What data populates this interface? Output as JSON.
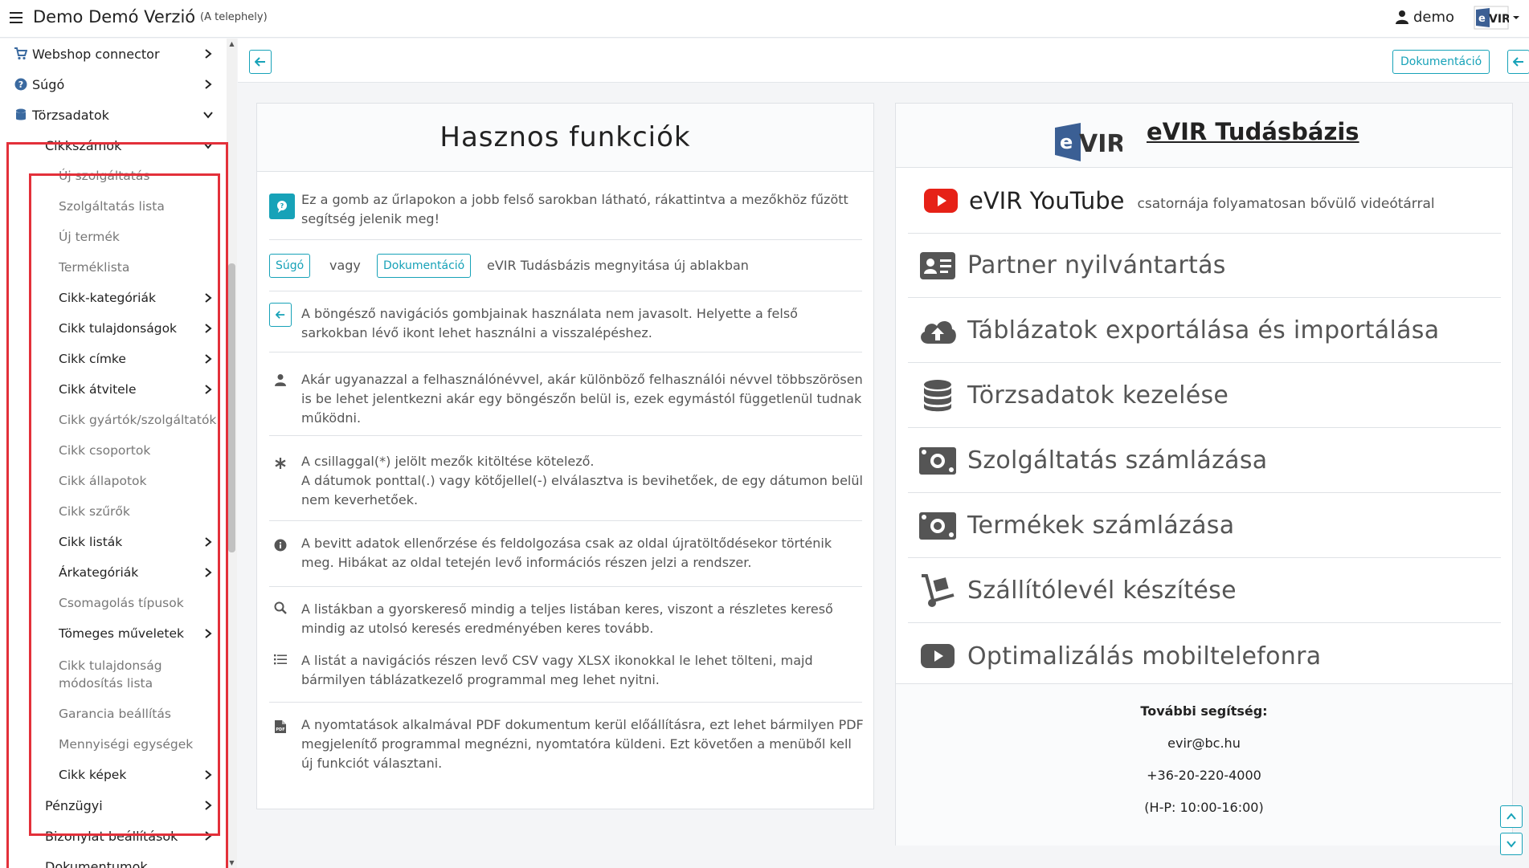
{
  "header": {
    "title": "Demo Demó Verzió",
    "subtitle": "(A telephely)",
    "user_name": "demo",
    "logo_text": "eVIR"
  },
  "sidebar": {
    "items_top": [
      {
        "label": "Webshop connector",
        "icon": "cart-icon"
      },
      {
        "label": "Súgó",
        "icon": "question-circle-icon"
      },
      {
        "label": "Törzsadatok",
        "icon": "database-icon",
        "expanded": true
      }
    ],
    "group": {
      "label": "Cikkszámok",
      "expanded": true
    },
    "sub_items": [
      {
        "label": "Új szolgáltatás",
        "has_children": false
      },
      {
        "label": "Szolgáltatás lista",
        "has_children": false
      },
      {
        "label": "Új termék",
        "has_children": false
      },
      {
        "label": "Terméklista",
        "has_children": false
      },
      {
        "label": "Cikk-kategóriák",
        "has_children": true
      },
      {
        "label": "Cikk tulajdonságok",
        "has_children": true
      },
      {
        "label": "Cikk címke",
        "has_children": true
      },
      {
        "label": "Cikk átvitele",
        "has_children": true
      },
      {
        "label": "Cikk gyártók/szolgáltatók",
        "has_children": false
      },
      {
        "label": "Cikk csoportok",
        "has_children": false
      },
      {
        "label": "Cikk állapotok",
        "has_children": false
      },
      {
        "label": "Cikk szűrők",
        "has_children": false
      },
      {
        "label": "Cikk listák",
        "has_children": true
      },
      {
        "label": "Árkategóriák",
        "has_children": true
      },
      {
        "label": "Csomagolás típusok",
        "has_children": false
      },
      {
        "label": "Tömeges műveletek",
        "has_children": true
      },
      {
        "label_line1": "Cikk tulajdonság",
        "label_line2": "módosítás lista",
        "has_children": false
      },
      {
        "label": "Garancia beállítás",
        "has_children": false
      },
      {
        "label": "Mennyiségi egységek",
        "has_children": false
      },
      {
        "label": "Cikk képek",
        "has_children": true
      }
    ],
    "items_after": [
      {
        "label": "Pénzügyi"
      },
      {
        "label": "Bizonylat beállítások"
      },
      {
        "label": "Dokumentumok"
      }
    ],
    "highlight_color": "#e3303a"
  },
  "toolbar": {
    "documentation_label": "Dokumentáció"
  },
  "useful": {
    "title": "Hasznos funkciók",
    "help_text": "Ez a gomb az űrlapokon a jobb felső sarokban látható, rákattintva a mezőkhöz fűzött segítség jelenik meg!",
    "sugo_label": "Súgó",
    "or_text": "vagy",
    "doc_label": "Dokumentáció",
    "kb_open_text": "eVIR Tudásbázis megnyitása új ablakban",
    "nav_text": "A böngésző navigációs gombjainak használata nem javasolt. Helyette a felső sarkokban lévő ikont lehet használni a visszalépéshez.",
    "user_text": "Akár ugyanazzal a felhasználónévvel, akár különböző felhasználói névvel többszörösen is be lehet jelentkezni akár egy böngészőn belül is, ezek egymástól függetlenül tudnak működni.",
    "star_text": "A csillaggal(*) jelölt mezők kitöltése kötelező.",
    "date_text": "A dátumok ponttal(.) vagy kötőjellel(-) elválasztva is bevihetőek, de egy dátumon belül nem keverhetőek.",
    "info_text": "A bevitt adatok ellenőrzése és feldolgozása csak az oldal újratöltődésekor történik meg. Hibákat az oldal tetején levő információs részen jelzi a rendszer.",
    "search_text": "A listákban a gyorskereső mindig a teljes listában keres, viszont a részletes kereső mindig az utolsó keresés eredményében keres tovább.",
    "list_text": "A listát a navigációs részen levő CSV vagy XLSX ikonokkal le lehet tölteni, majd bármilyen táblázatkezelő programmal meg lehet nyitni.",
    "pdf_text": "A nyomtatások alkalmával PDF dokumentum kerül előállításra, ezt lehet bármilyen PDF megjelenítő programmal megnézni, nyomtatóra küldeni. Ezt követően a menüből kell új funkciót választani."
  },
  "knowledge": {
    "title": "eVIR Tudásbázis",
    "logo_text": "eVIR",
    "youtube_label": "eVIR YouTube",
    "youtube_desc": "csatornája folyamatosan bővülő videótárral",
    "items": [
      {
        "label": "Partner nyilvántartás",
        "icon": "id-card-icon"
      },
      {
        "label": "Táblázatok exportálása és importálása",
        "icon": "cloud-upload-icon"
      },
      {
        "label": "Törzsadatok kezelése",
        "icon": "database-icon"
      },
      {
        "label": "Szolgáltatás számlázása",
        "icon": "money-bill-icon"
      },
      {
        "label": "Termékek számlázása",
        "icon": "money-bill-icon"
      },
      {
        "label": "Szállítólevél készítése",
        "icon": "dolly-icon"
      },
      {
        "label": "Optimalizálás mobiltelefonra",
        "icon": "youtube-icon"
      }
    ],
    "help_title": "További segítség:",
    "email": "evir@bc.hu",
    "phone": "+36-20-220-4000",
    "hours": "(H-P: 10:00-16:00)"
  },
  "colors": {
    "accent": "#17a2b8",
    "youtube_red": "#e62117",
    "icon_gray": "#555555"
  }
}
